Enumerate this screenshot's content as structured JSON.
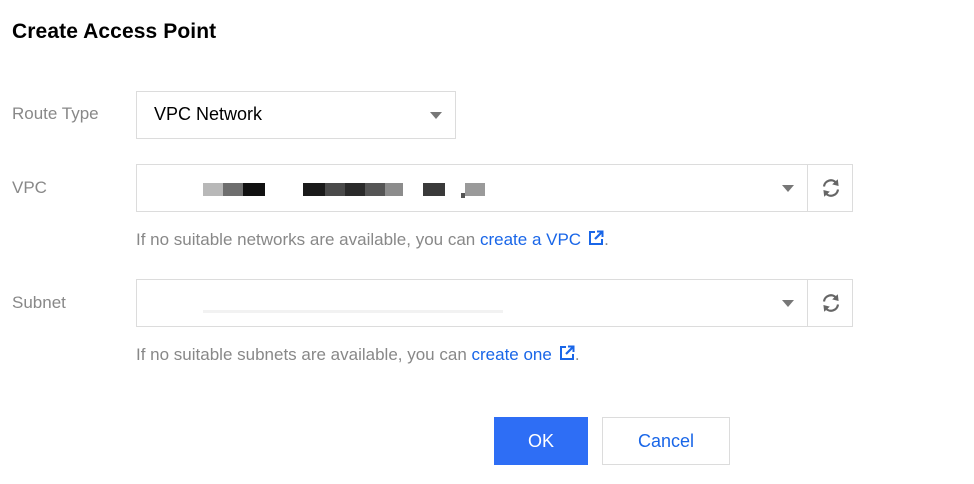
{
  "dialog": {
    "title": "Create Access Point",
    "route_type": {
      "label": "Route Type",
      "value": "VPC Network"
    },
    "vpc": {
      "label": "VPC",
      "hint_prefix": "If no suitable networks are available, you can ",
      "link_text": "create a VPC",
      "hint_suffix": "."
    },
    "subnet": {
      "label": "Subnet",
      "hint_prefix": "If no suitable subnets are available, you can ",
      "link_text": "create one",
      "hint_suffix": "."
    },
    "buttons": {
      "ok": "OK",
      "cancel": "Cancel"
    },
    "icons": {
      "dropdown": "chevron-down-icon",
      "refresh": "refresh-icon",
      "external": "external-link-icon"
    },
    "colors": {
      "primary": "#2e6ef5",
      "link": "#1966e8",
      "label": "#888888",
      "border": "#dcdcdc"
    }
  }
}
